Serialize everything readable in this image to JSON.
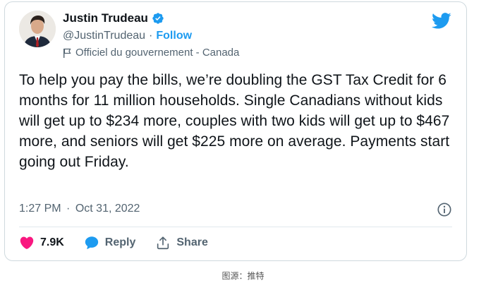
{
  "author": {
    "name": "Justin Trudeau",
    "handle": "@JustinTrudeau",
    "separator": "·",
    "follow_label": "Follow",
    "account_label": "Officiel du gouvernement - Canada"
  },
  "tweet": {
    "text": "To help you pay the bills, we’re doubling the GST Tax Credit for 6 months for 11 million households. Single Canadians without kids will get up to $234 more, couples with two kids will get up to $467 more, and seniors will get $225 more on average. Payments start going out Friday.",
    "time": "1:27 PM",
    "date": "Oct 31, 2022",
    "separator": "·"
  },
  "actions": {
    "likes_count": "7.9K",
    "reply_label": "Reply",
    "share_label": "Share"
  },
  "caption": "图源：推特",
  "colors": {
    "brand_blue": "#1d9bf0",
    "like_pink": "#f91880",
    "text_primary": "#0f1419",
    "text_secondary": "#536471"
  },
  "icons": [
    "verified-badge-icon",
    "government-flag-icon",
    "twitter-logo-icon",
    "info-icon",
    "heart-icon",
    "reply-bubble-icon",
    "share-icon"
  ]
}
